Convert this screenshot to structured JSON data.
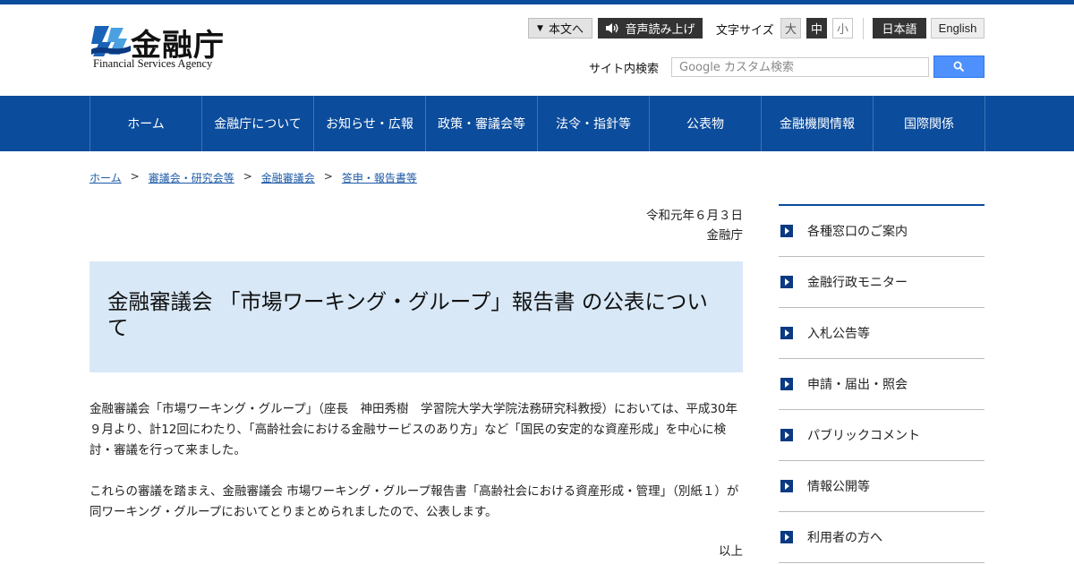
{
  "header": {
    "logo_kanji": "金融庁",
    "logo_english": "Financial Services Agency",
    "skip_link": "本文へ",
    "read_aloud": "音声読み上げ",
    "font_size_label": "文字サイズ",
    "font_sizes": [
      "大",
      "中",
      "小"
    ],
    "lang_japanese": "日本語",
    "lang_english": "English",
    "search_label": "サイト内検索",
    "search_placeholder": "Google カスタム検索",
    "colors": {
      "brand_blue": "#0b4c9c",
      "search_button": "#4d90fe"
    },
    "icons": {
      "skip": "triangle-down-icon",
      "read_aloud": "speaker-icon",
      "search": "magnifier-icon"
    }
  },
  "nav": {
    "items": [
      "ホーム",
      "金融庁について",
      "お知らせ・広報",
      "政策・審議会等",
      "法令・指針等",
      "公表物",
      "金融機関情報",
      "国際関係"
    ]
  },
  "breadcrumb": {
    "items": [
      "ホーム",
      "審議会・研究会等",
      "金融審議会",
      "答申・報告書等"
    ],
    "separator": ">"
  },
  "main": {
    "date": "令和元年６月３日",
    "issuer": "金融庁",
    "title": "金融審議会 「市場ワーキング・グループ」報告書 の公表について",
    "paragraph1": "金融審議会「市場ワーキング・グループ」（座長　神田秀樹　学習院大学大学院法務研究科教授）においては、平成30年９月より、計12回にわたり、「高齢社会における金融サービスのあり方」など「国民の安定的な資産形成」を中心に検討・審議を行って来ました。",
    "paragraph2": "これらの審議を踏まえ、金融審議会 市場ワーキング・グループ報告書「高齢社会における資産形成・管理」（別紙１）が同ワーキング・グループにおいてとりまとめられましたので、公表します。",
    "closing": "以上"
  },
  "sidebar": {
    "items": [
      "各種窓口のご案内",
      "金融行政モニター",
      "入札公告等",
      "申請・届出・照会",
      "パブリックコメント",
      "情報公開等",
      "利用者の方へ"
    ]
  }
}
